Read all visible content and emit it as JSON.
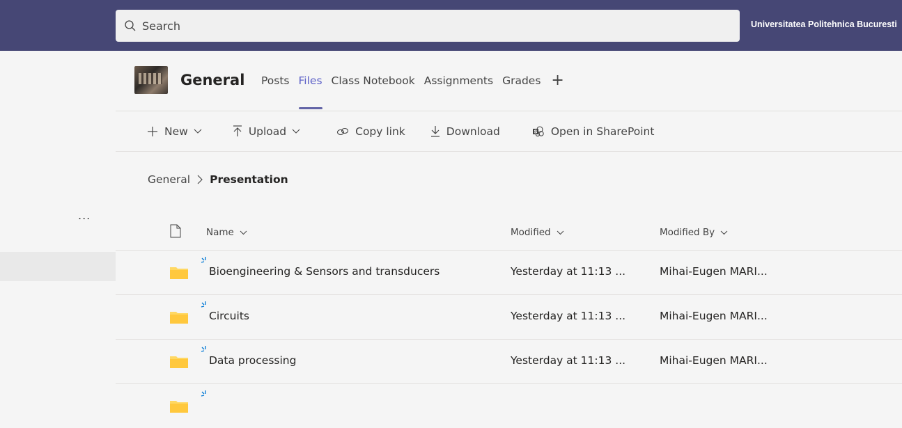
{
  "search": {
    "placeholder": "Search"
  },
  "org_name": "Universitatea Politehnica Bucuresti",
  "left_rail": {
    "more_label": "..."
  },
  "channel": {
    "name": "General"
  },
  "tabs": [
    {
      "label": "Posts"
    },
    {
      "label": "Files",
      "active": true
    },
    {
      "label": "Class Notebook"
    },
    {
      "label": "Assignments"
    },
    {
      "label": "Grades"
    }
  ],
  "add_tab_label": "+",
  "toolbar": {
    "new": "New",
    "upload": "Upload",
    "copy_link": "Copy link",
    "download": "Download",
    "open_sharepoint": "Open in SharePoint"
  },
  "breadcrumb": {
    "parent": "General",
    "separator": ">",
    "current": "Presentation"
  },
  "columns": {
    "name": "Name",
    "modified": "Modified",
    "modified_by": "Modified By"
  },
  "files": [
    {
      "name": "Bioengineering & Sensors and transducers",
      "modified": "Yesterday at 11:13 ...",
      "modified_by": "Mihai-Eugen MARI..."
    },
    {
      "name": "Circuits",
      "modified": "Yesterday at 11:13 ...",
      "modified_by": "Mihai-Eugen MARI..."
    },
    {
      "name": "Data processing",
      "modified": "Yesterday at 11:13 ...",
      "modified_by": "Mihai-Eugen MARI..."
    },
    {
      "name": "",
      "modified": "",
      "modified_by": ""
    }
  ],
  "colors": {
    "topbar": "#464775",
    "accent": "#6264a7",
    "folder": "#ffd863",
    "new_item": "#0078d4"
  }
}
